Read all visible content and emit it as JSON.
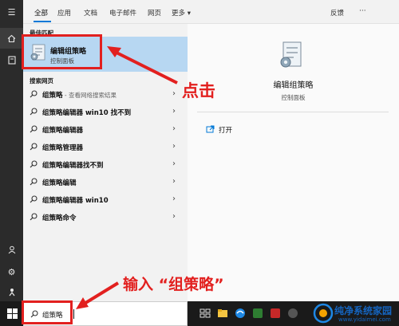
{
  "header": {
    "tabs": [
      "全部",
      "应用",
      "文档",
      "电子邮件",
      "网页",
      "更多 ▾"
    ],
    "feedback": "反馈",
    "more_options": "···"
  },
  "sections": {
    "best_match": "最佳匹配",
    "web": "搜索网页"
  },
  "best_match": {
    "title": "编辑组策略",
    "subtitle": "控制面板"
  },
  "web_results": [
    {
      "bold": "组策略",
      "rest": "",
      "sub": " - 查看网络搜索结果"
    },
    {
      "bold": "组策略编辑器 win10 找不到",
      "rest": "",
      "sub": ""
    },
    {
      "bold": "组策略编辑器",
      "rest": "",
      "sub": ""
    },
    {
      "bold": "组策略管理器",
      "rest": "",
      "sub": ""
    },
    {
      "bold": "组策略编辑器找不到",
      "rest": "",
      "sub": ""
    },
    {
      "bold": "组策略编辑",
      "rest": "",
      "sub": ""
    },
    {
      "bold": "组策略编辑器 win10",
      "rest": "",
      "sub": ""
    },
    {
      "bold": "组策略命令",
      "rest": "",
      "sub": ""
    }
  ],
  "detail": {
    "title": "编辑组策略",
    "subtitle": "控制面板",
    "action_open": "打开"
  },
  "search": {
    "value": "组策略"
  },
  "annotations": {
    "click": "点击",
    "type": "输入 “组策略”"
  },
  "watermark": {
    "title": "纯净系统家园",
    "url": "www.yidaimei.com"
  },
  "colors": {
    "accent": "#0078d7",
    "highlight": "#b7d7f2",
    "annotation": "#e2201f",
    "rail": "#2b2b2b",
    "taskbar": "#1a1a1a"
  }
}
